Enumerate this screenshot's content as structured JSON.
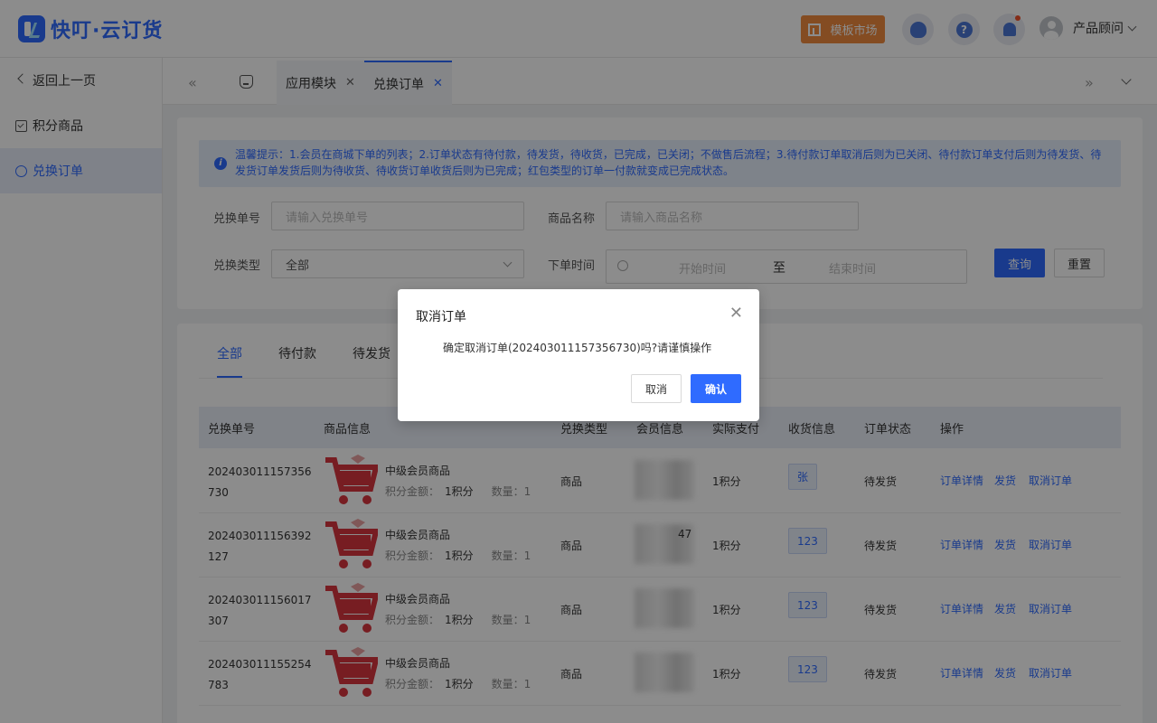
{
  "app": {
    "logo_text": "快叮·云订货"
  },
  "header": {
    "market_button": "模板市场",
    "user_name": "产品顾问",
    "help_glyph": "?",
    "icons": [
      "service-icon",
      "help-icon",
      "bell-icon",
      "avatar"
    ]
  },
  "sidebar": {
    "back": "返回上一页",
    "items": [
      {
        "label": "积分商品",
        "icon": "product-box-icon"
      },
      {
        "label": "兑换订单",
        "icon": "exchange-icon"
      }
    ]
  },
  "tabbar": {
    "prev": "«",
    "next": "»",
    "tabs": [
      {
        "label": "应用模块",
        "close": "✕"
      },
      {
        "label": "兑换订单",
        "close": "✕"
      }
    ]
  },
  "notice": {
    "icon_glyph": "i",
    "line1": "温馨提示：1.会员在商城下单的列表；2.订单状态有待付款，待发货，待收货，已完成，已关闭；不做售后流程；3.待付款订单取消后则为已关闭、待付款订单支付后则为待发货、待",
    "line2": "发货订单发货后则为待收货、待收货订单收货后则为已完成；红包类型的订单一付款就变成已完成状态。"
  },
  "filters": {
    "order_no_label": "兑换单号",
    "order_no_placeholder": "请输入兑换单号",
    "product_label": "商品名称",
    "product_placeholder": "请输入商品名称",
    "type_label": "兑换类型",
    "type_value": "全部",
    "time_label": "下单时间",
    "start_placeholder": "开始时间",
    "to": "至",
    "end_placeholder": "结束时间",
    "query": "查询",
    "reset": "重置"
  },
  "order_tabs": [
    "全部",
    "待付款",
    "待发货"
  ],
  "table": {
    "headers": [
      "兑换单号",
      "商品信息",
      "兑换类型",
      "会员信息",
      "实际支付",
      "收货信息",
      "订单状态",
      "操作"
    ],
    "rows": [
      {
        "order_no": "202403011157356730",
        "product": "中级会员商品",
        "points_label": "积分金额：",
        "points": "1积分",
        "qty_label": "数量：",
        "qty": "1",
        "type": "商品",
        "pay": "1积分",
        "receiver": "张",
        "status": "待发货",
        "actions": [
          "订单详情",
          "发货",
          "取消订单"
        ]
      },
      {
        "order_no": "202403011156392127",
        "product": "中级会员商品",
        "points_label": "积分金额：",
        "points": "1积分",
        "qty_label": "数量：",
        "qty": "1",
        "type": "商品",
        "pay": "1积分",
        "receiver": "123",
        "status": "待发货",
        "actions": [
          "订单详情",
          "发货",
          "取消订单"
        ]
      },
      {
        "order_no": "202403011156017307",
        "product": "中级会员商品",
        "points_label": "积分金额：",
        "points": "1积分",
        "qty_label": "数量：",
        "qty": "1",
        "type": "商品",
        "pay": "1积分",
        "receiver": "123",
        "status": "待发货",
        "actions": [
          "订单详情",
          "发货",
          "取消订单"
        ]
      },
      {
        "order_no": "202403011155254783",
        "product": "中级会员商品",
        "points_label": "积分金额：",
        "points": "1积分",
        "qty_label": "数量：",
        "qty": "1",
        "type": "商品",
        "pay": "1积分",
        "receiver": "123",
        "status": "待发货",
        "actions": [
          "订单详情",
          "发货",
          "取消订单"
        ]
      }
    ],
    "member_partial": "47"
  },
  "modal": {
    "title": "取消订单",
    "close": "✕",
    "message": "确定取消订单(202403011157356730)吗?请谨慎操作",
    "cancel": "取消",
    "confirm": "确认"
  },
  "colors": {
    "accent": "#2f6bff",
    "market": "#f08a3e",
    "cart": "#d9363e"
  }
}
